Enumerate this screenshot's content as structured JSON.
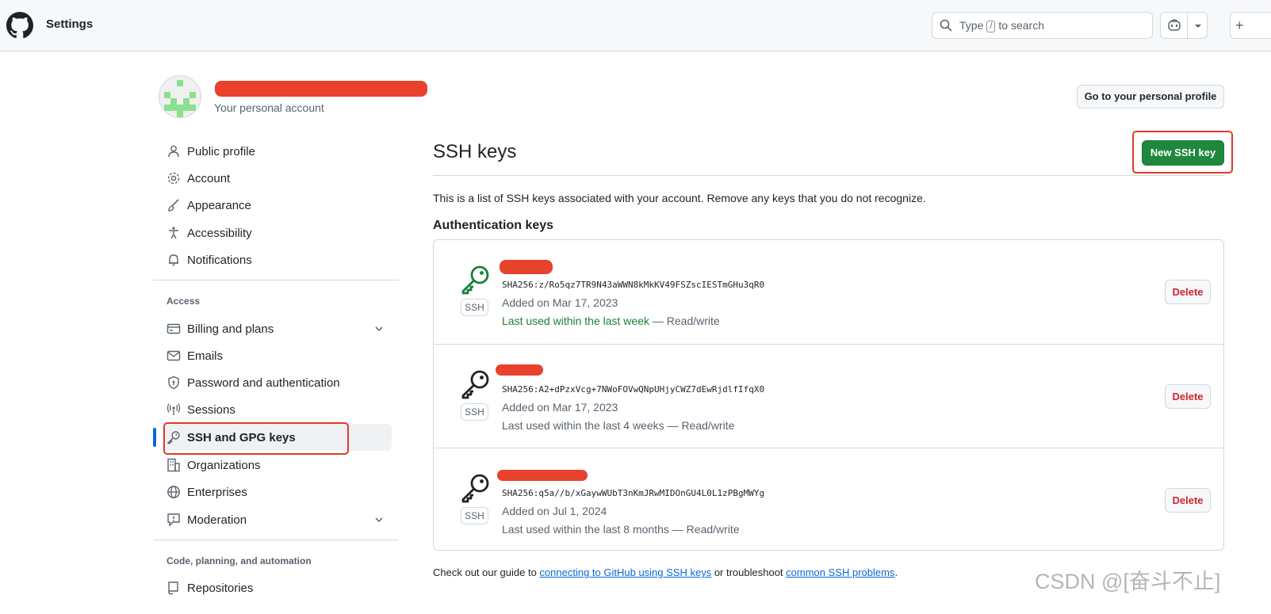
{
  "header": {
    "title": "Settings",
    "search_prefix": "Type",
    "search_key": "/",
    "search_suffix": "to search",
    "plus_label": "+"
  },
  "profile": {
    "subtitle": "Your personal account",
    "go_profile_label": "Go to your personal profile"
  },
  "sidebar": {
    "items": [
      {
        "label": "Public profile",
        "icon": "person-icon"
      },
      {
        "label": "Account",
        "icon": "gear-icon"
      },
      {
        "label": "Appearance",
        "icon": "paintbrush-icon"
      },
      {
        "label": "Accessibility",
        "icon": "accessibility-icon"
      },
      {
        "label": "Notifications",
        "icon": "bell-icon"
      }
    ],
    "access_heading": "Access",
    "access_items": [
      {
        "label": "Billing and plans",
        "icon": "credit-card-icon"
      },
      {
        "label": "Emails",
        "icon": "mail-icon"
      },
      {
        "label": "Password and authentication",
        "icon": "shield-lock-icon"
      },
      {
        "label": "Sessions",
        "icon": "broadcast-icon"
      },
      {
        "label": "SSH and GPG keys",
        "icon": "key-icon",
        "active": true
      },
      {
        "label": "Organizations",
        "icon": "organization-icon"
      },
      {
        "label": "Enterprises",
        "icon": "globe-icon"
      },
      {
        "label": "Moderation",
        "icon": "report-icon"
      }
    ],
    "code_heading": "Code, planning, and automation",
    "code_items": [
      {
        "label": "Repositories",
        "icon": "repo-icon"
      }
    ]
  },
  "main": {
    "title": "SSH keys",
    "new_key_label": "New SSH key",
    "description": "This is a list of SSH keys associated with your account. Remove any keys that you do not recognize.",
    "auth_heading": "Authentication keys",
    "ssh_badge": "SSH",
    "delete_label": "Delete",
    "keys": [
      {
        "fingerprint": "SHA256:z/Ro5qz7TR9N43aWWN8kMkKV49FSZscIESTmGHu3qR0",
        "added": "Added on Mar 17, 2023",
        "used_text": "Last used within the last week",
        "access": " — Read/write",
        "recent": true
      },
      {
        "fingerprint": "SHA256:A2+dPzxVcg+7NWoFOVwQNpUHjyCWZ7dEwRjdlfIfqX0",
        "added": "Added on Mar 17, 2023",
        "used_text": "Last used within the last 4 weeks",
        "access": " — Read/write",
        "recent": false
      },
      {
        "fingerprint": "SHA256:q5a//b/xGaywWUbT3nKmJRwMIDOnGU4L0L1zPBgMWYg",
        "added": "Added on Jul 1, 2024",
        "used_text": "Last used within the last 8 months",
        "access": " — Read/write",
        "recent": false
      }
    ]
  },
  "footer": {
    "prefix": "Check out our guide to ",
    "link1": "connecting to GitHub using SSH keys",
    "middle": " or troubleshoot ",
    "link2": "common SSH problems",
    "suffix": "."
  },
  "watermark": "CSDN @[奋斗不止]",
  "colors": {
    "accent_green": "#1f883d",
    "danger_red": "#d1242f",
    "link_blue": "#0969da",
    "annotation_red": "#e0392a"
  }
}
